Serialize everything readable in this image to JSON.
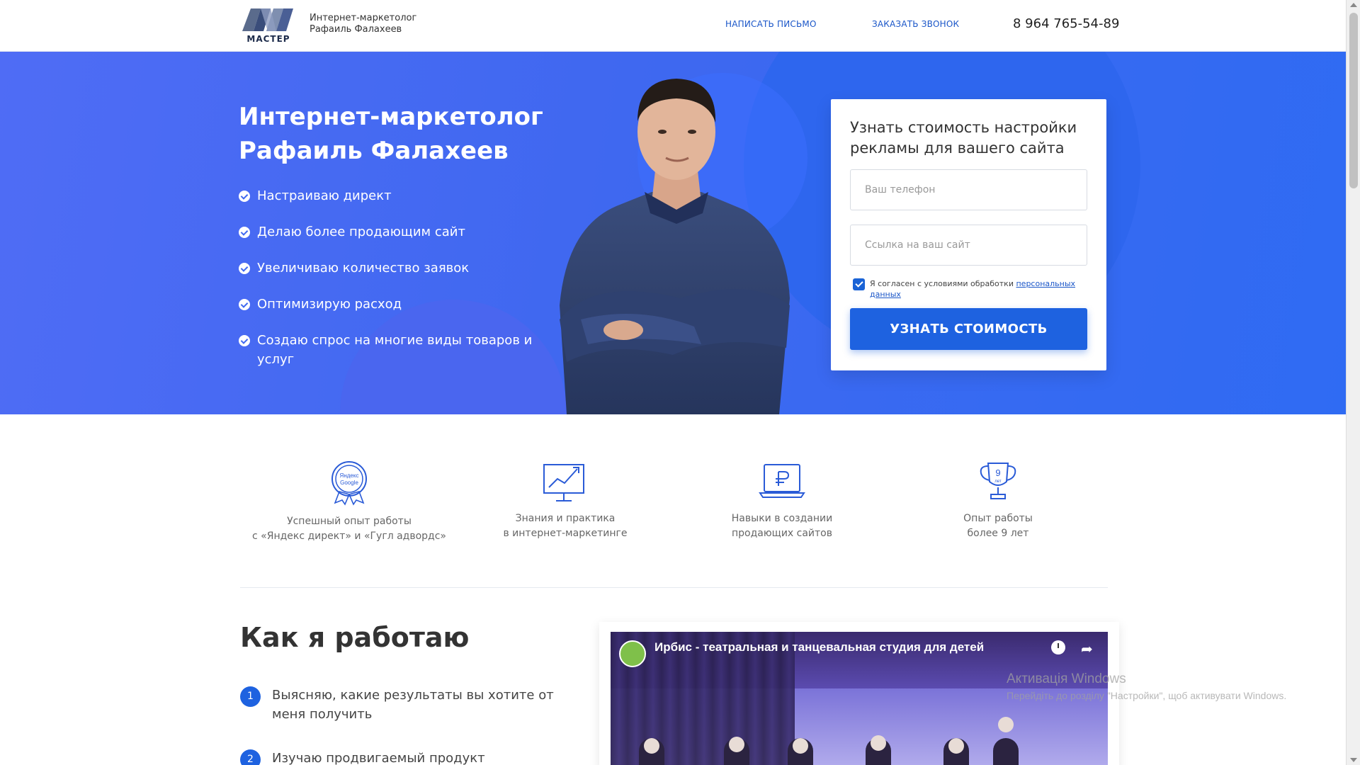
{
  "header": {
    "logo_text": "МАСТЕР",
    "brand_line1": "Интернет-маркетолог",
    "brand_line2": "Рафаиль Фалахеев",
    "nav_write": "НАПИСАТЬ ПИСЬМО",
    "nav_call": "ЗАКАЗАТЬ ЗВОНОК",
    "phone": "8 964 765-54-89"
  },
  "hero": {
    "title_line1": "Интернет-маркетолог",
    "title_line2": "Рафаиль Фалахеев",
    "bullets": [
      "Настраиваю директ",
      "Делаю более продающим сайт",
      "Увеличиваю количество заявок",
      "Оптимизирую расход",
      "Создаю спрос на многие виды товаров и услуг"
    ]
  },
  "form": {
    "title": "Узнать стоимость настройки рекламы для вашего сайта",
    "phone_placeholder": "Ваш телефон",
    "site_placeholder": "Ссылка на ваш сайт",
    "agree_text": "Я согласен с условиями обработки ",
    "agree_link": "персональных данных",
    "agree_checked": true,
    "submit_label": "УЗНАТЬ СТОИМОСТЬ"
  },
  "features": [
    {
      "icon": "yandex-google-medal-icon",
      "badge_line1": "Яндекс",
      "badge_line2": "Google",
      "line1": "Успешный опыт работы",
      "line2": "с «Яндекс директ» и «Гугл адвордс»"
    },
    {
      "icon": "growth-chart-monitor-icon",
      "line1": "Знания и практика",
      "line2": "в интернет-маркетинге"
    },
    {
      "icon": "ruble-laptop-icon",
      "line1": "Навыки в создании",
      "line2": "продающих сайтов"
    },
    {
      "icon": "trophy-icon",
      "badge_line1": "9",
      "badge_line2": "лет",
      "line1": "Опыт работы",
      "line2": "более 9 лет"
    }
  ],
  "how": {
    "title": "Как я работаю",
    "steps": [
      {
        "num": "1",
        "text": "Выясняю, какие результаты вы хотите от меня получить"
      },
      {
        "num": "2",
        "text": "Изучаю продвигаемый продукт"
      }
    ]
  },
  "video": {
    "title": "Ирбис - театральная и танцевальная студия для детей"
  },
  "watermark": {
    "line1": "Активація Windows",
    "line2": "Перейдіть до розділу \"Настройки\", щоб активувати Windows."
  },
  "colors": {
    "accent": "#1e62e0",
    "hero_bg": "#3f68f0",
    "link": "#1a56c8"
  }
}
